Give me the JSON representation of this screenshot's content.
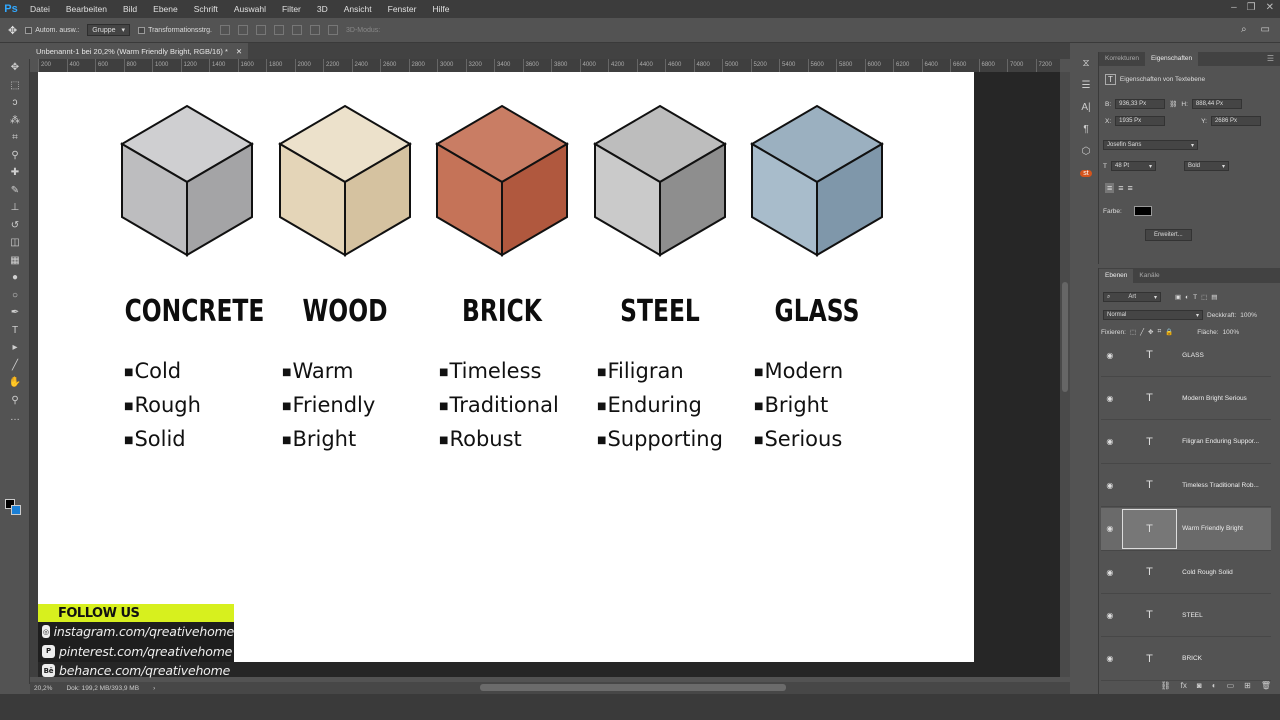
{
  "app": {
    "logo": "Ps"
  },
  "menu": [
    "Datei",
    "Bearbeiten",
    "Bild",
    "Ebene",
    "Schrift",
    "Auswahl",
    "Filter",
    "3D",
    "Ansicht",
    "Fenster",
    "Hilfe"
  ],
  "options": {
    "auto_select": "Autom. ausw.:",
    "group": "Gruppe",
    "transform": "Transformationsstrg.",
    "mode3d": "3D-Modus:"
  },
  "document": {
    "tab_title": "Unbenannt-1 bei 20,2% (Warm Friendly Bright, RGB/16) *"
  },
  "ruler": [
    "200",
    "400",
    "600",
    "800",
    "1000",
    "1200",
    "1400",
    "1600",
    "1800",
    "2000",
    "2200",
    "2400",
    "2600",
    "2800",
    "3000",
    "3200",
    "3400",
    "3600",
    "3800",
    "4000",
    "4200",
    "4400",
    "4600",
    "4800",
    "5000",
    "5200",
    "5400",
    "5600",
    "5800",
    "6000",
    "6200",
    "6400",
    "6600",
    "6800",
    "7000",
    "7200"
  ],
  "materials": [
    {
      "title": "CONCRETE",
      "items": [
        "Cold",
        "Rough",
        "Solid"
      ],
      "colors": {
        "top": "#cfcfd1",
        "left": "#bdbdbf",
        "right": "#a4a4a6"
      }
    },
    {
      "title": "WOOD",
      "items": [
        "Warm",
        "Friendly",
        "Bright"
      ],
      "colors": {
        "top": "#ece1cb",
        "left": "#e4d5b8",
        "right": "#d5c2a0"
      }
    },
    {
      "title": "BRICK",
      "items": [
        "Timeless",
        "Traditional",
        "Robust"
      ],
      "colors": {
        "top": "#c97d64",
        "left": "#c57358",
        "right": "#b0583e"
      }
    },
    {
      "title": "STEEL",
      "items": [
        "Filigran",
        "Enduring",
        "Supporting"
      ],
      "colors": {
        "top": "#bdbdbd",
        "left": "#cacaca",
        "right": "#8e8e8e"
      }
    },
    {
      "title": "GLASS",
      "items": [
        "Modern",
        "Bright",
        "Serious"
      ],
      "colors": {
        "top": "#9bb0c0",
        "left": "#a8bccb",
        "right": "#7f97aa"
      }
    }
  ],
  "follow": {
    "heading": "FOLLOW US",
    "links": [
      {
        "icon": "instagram-icon",
        "glyph": "◎",
        "text": "instagram.com/qreativehome"
      },
      {
        "icon": "pinterest-icon",
        "glyph": "P",
        "text": "pinterest.com/qreativehome"
      },
      {
        "icon": "behance-icon",
        "glyph": "Bē",
        "text": "behance.com/qreativehome"
      }
    ]
  },
  "status": {
    "zoom": "20,2%",
    "doc": "Dok: 199,2 MB/393,9 MB"
  },
  "properties": {
    "tabs": [
      "Korrekturen",
      "Eigenschaften"
    ],
    "active_tab": "Eigenschaften",
    "heading": "Eigenschaften von Textebene",
    "b_label": "B:",
    "b": "936,33 Px",
    "h_label": "H:",
    "h": "888,44 Px",
    "x_label": "X:",
    "x": "1935 Px",
    "y_label": "Y:",
    "y": "2686 Px",
    "font": "Josefin Sans",
    "size": "48 Pt",
    "weight": "Bold",
    "color_label": "Farbe:",
    "color": "#000000",
    "more_button": "Erweitert..."
  },
  "layers": {
    "tabs": [
      "Ebenen",
      "Kanäle"
    ],
    "filter": "Art",
    "blend": "Normal",
    "opacity_label": "Deckkraft:",
    "opacity": "100%",
    "lock_label": "Fixieren:",
    "fill_label": "Fläche:",
    "fill": "100%",
    "items": [
      {
        "name": "GLASS",
        "selected": false
      },
      {
        "name": "Modern Bright Serious",
        "selected": false
      },
      {
        "name": "Filigran Enduring Suppor...",
        "selected": false
      },
      {
        "name": "Timeless Traditional Rob...",
        "selected": false
      },
      {
        "name": "Warm Friendly Bright",
        "selected": true
      },
      {
        "name": "Cold Rough Solid",
        "selected": false
      },
      {
        "name": "STEEL",
        "selected": false
      },
      {
        "name": "BRICK",
        "selected": false
      }
    ]
  }
}
